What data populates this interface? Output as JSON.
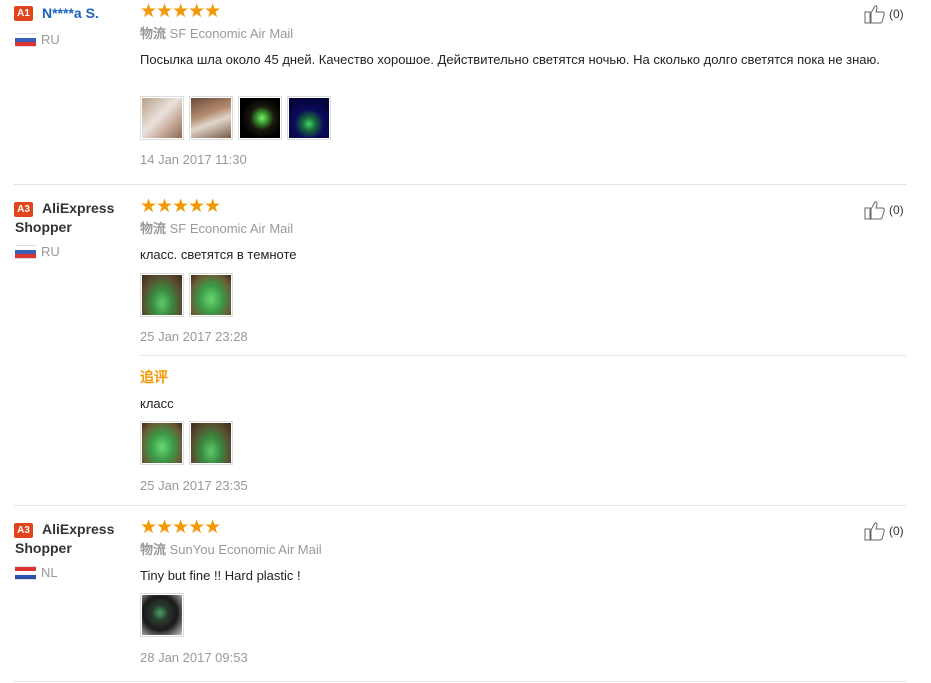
{
  "reviews": [
    {
      "level": "A1",
      "user": "N****a S.",
      "country": "RU",
      "stars": "★★★★★",
      "logistics_label": "物流",
      "logistics": "SF Economic Air Mail",
      "text": "Посылка шла около 45 дней. Качество хорошое. Действительно светятся ночью. На сколько долго светятся пока не знаю.",
      "date": "14 Jan 2017 11:30",
      "likes": "(0)"
    },
    {
      "level": "A3",
      "user": "AliExpress",
      "user_line2": "Shopper",
      "country": "RU",
      "stars": "★★★★★",
      "logistics_label": "物流",
      "logistics": "SF Economic Air Mail",
      "text": "класс. светятся в темноте",
      "date": "25 Jan 2017 23:28",
      "likes": "(0)",
      "followup": {
        "label": "追评",
        "text": "класс",
        "date": "25 Jan 2017 23:35"
      }
    },
    {
      "level": "A3",
      "user": "AliExpress",
      "user_line2": "Shopper",
      "country": "NL",
      "stars": "★★★★★",
      "logistics_label": "物流",
      "logistics": "SunYou Economic Air Mail",
      "text": "Tiny but fine !! Hard plastic !",
      "date": "28 Jan 2017 09:53",
      "likes": "(0)"
    }
  ],
  "colors": {
    "accent": "#f39800",
    "link": "#1f63b8",
    "badge": "#e0451c"
  },
  "icons": [
    "thumbs-up-icon",
    "flag-ru-icon",
    "flag-nl-icon"
  ]
}
